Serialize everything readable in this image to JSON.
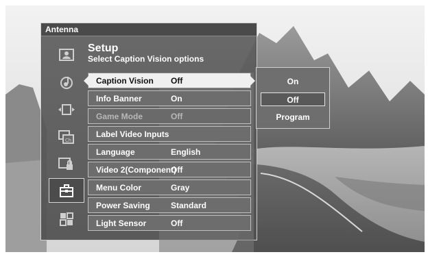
{
  "header": {
    "source": "Antenna"
  },
  "menu": {
    "title": "Setup",
    "subtitle": "Select Caption Vision options"
  },
  "sidebar": {
    "icons": [
      {
        "name": "picture-icon",
        "active": false
      },
      {
        "name": "audio-icon",
        "active": false
      },
      {
        "name": "screen-size-icon",
        "active": false
      },
      {
        "name": "channels-icon",
        "active": false
      },
      {
        "name": "parental-lock-icon",
        "active": false
      },
      {
        "name": "setup-icon",
        "active": true
      },
      {
        "name": "applications-icon",
        "active": false
      }
    ]
  },
  "settings": [
    {
      "label": "Caption Vision",
      "value": "Off",
      "state": "selected"
    },
    {
      "label": "Info Banner",
      "value": "On",
      "state": "normal"
    },
    {
      "label": "Game Mode",
      "value": "Off",
      "state": "disabled"
    },
    {
      "label": "Label Video Inputs",
      "value": "",
      "state": "normal"
    },
    {
      "label": "Language",
      "value": "English",
      "state": "normal"
    },
    {
      "label": "Video 2(Component)",
      "value": "Off",
      "state": "normal"
    },
    {
      "label": "Menu Color",
      "value": "Gray",
      "state": "normal"
    },
    {
      "label": "Power Saving",
      "value": "Standard",
      "state": "normal"
    },
    {
      "label": "Light Sensor",
      "value": "Off",
      "state": "normal"
    }
  ],
  "options": [
    {
      "label": "On",
      "selected": false
    },
    {
      "label": "Off",
      "selected": true
    },
    {
      "label": "Program",
      "selected": false
    }
  ],
  "colors": {
    "panel": "#5a5a5a",
    "selected_row": "#f0f0f0",
    "row": "#6d6d6d",
    "border": "#bfbfbf"
  }
}
